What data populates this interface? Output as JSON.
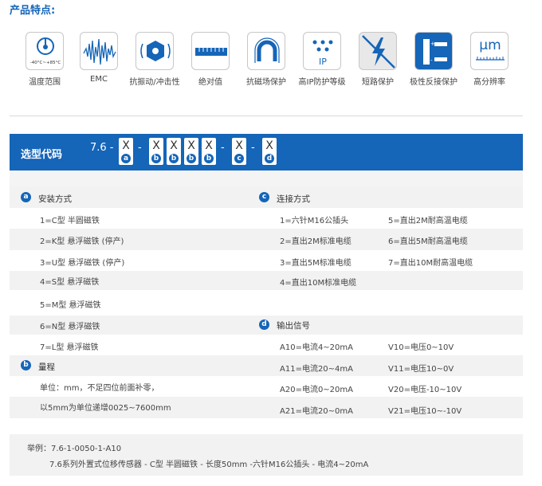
{
  "features_title": "产品特点:",
  "features": [
    {
      "label": "温度范围",
      "icon": "thermometer-icon",
      "temp_low": "-40°C~",
      "temp_high": "+85°C"
    },
    {
      "label": "EMC",
      "icon": "emc-wave-icon"
    },
    {
      "label": "抗振动/冲击性",
      "icon": "vibration-icon"
    },
    {
      "label": "绝对值",
      "icon": "absolute-scale-icon"
    },
    {
      "label": "抗磁场保护",
      "icon": "magnet-icon"
    },
    {
      "label": "高IP防护等级",
      "icon": "ip-rating-icon",
      "icon_text": "IP"
    },
    {
      "label": "短路保护",
      "icon": "short-circuit-icon"
    },
    {
      "label": "极性反接保护",
      "icon": "polarity-icon"
    },
    {
      "label": "高分辨率",
      "icon": "resolution-icon",
      "icon_text": "μm"
    }
  ],
  "model_code": {
    "title": "选型代码",
    "prefix": "7.6 -",
    "slots": [
      {
        "letter": "X",
        "badge": "a"
      },
      {
        "letter": "X",
        "badge": "b"
      },
      {
        "letter": "X",
        "badge": "b"
      },
      {
        "letter": "X",
        "badge": "b"
      },
      {
        "letter": "X",
        "badge": "b"
      },
      {
        "letter": "X",
        "badge": "c"
      },
      {
        "letter": "X",
        "badge": "d"
      }
    ],
    "dash": "-"
  },
  "sections": {
    "a": {
      "badge": "a",
      "title": "安装方式",
      "items": [
        "1=C型  半圆磁铁",
        "2=K型  悬浮磁铁 (停产)",
        "3=U型  悬浮磁铁 (停产)",
        "4=S型  悬浮磁铁",
        "5=M型  悬浮磁铁",
        "6=N型  悬浮磁铁",
        "7=L型  悬浮磁铁"
      ]
    },
    "b": {
      "badge": "b",
      "title": "量程",
      "items": [
        "单位：mm，不足四位前面补零，",
        "以5mm为单位递增0025~7600mm"
      ]
    },
    "c": {
      "badge": "c",
      "title": "连接方式",
      "col1": [
        "1=六针M16公插头",
        "2=直出2M标准电缆",
        "3=直出5M标准电缆",
        "4=直出10M标准电缆"
      ],
      "col2": [
        "5=直出2M耐高温电缆",
        "6=直出5M耐高温电缆",
        "7=直出10M耐高温电缆"
      ]
    },
    "d": {
      "badge": "d",
      "title": "输出信号",
      "col1": [
        "A10=电流4~20mA",
        "A11=电流20~4mA",
        "A20=电流0~20mA",
        "A21=电流20~0mA"
      ],
      "col2": [
        "V10=电压0~10V",
        "V11=电压10~0V",
        "V20=电压-10~10V",
        "V21=电压10~-10V"
      ]
    }
  },
  "example": {
    "line1": "举例：7.6-1-0050-1-A10",
    "line2": "7.6系列外置式位移传感器 - C型  半圆磁铁 - 长度50mm -六针M16公插头 - 电流4~20mA"
  },
  "colors": {
    "accent": "#1565b8",
    "row_grey": "#f2f2f2"
  }
}
